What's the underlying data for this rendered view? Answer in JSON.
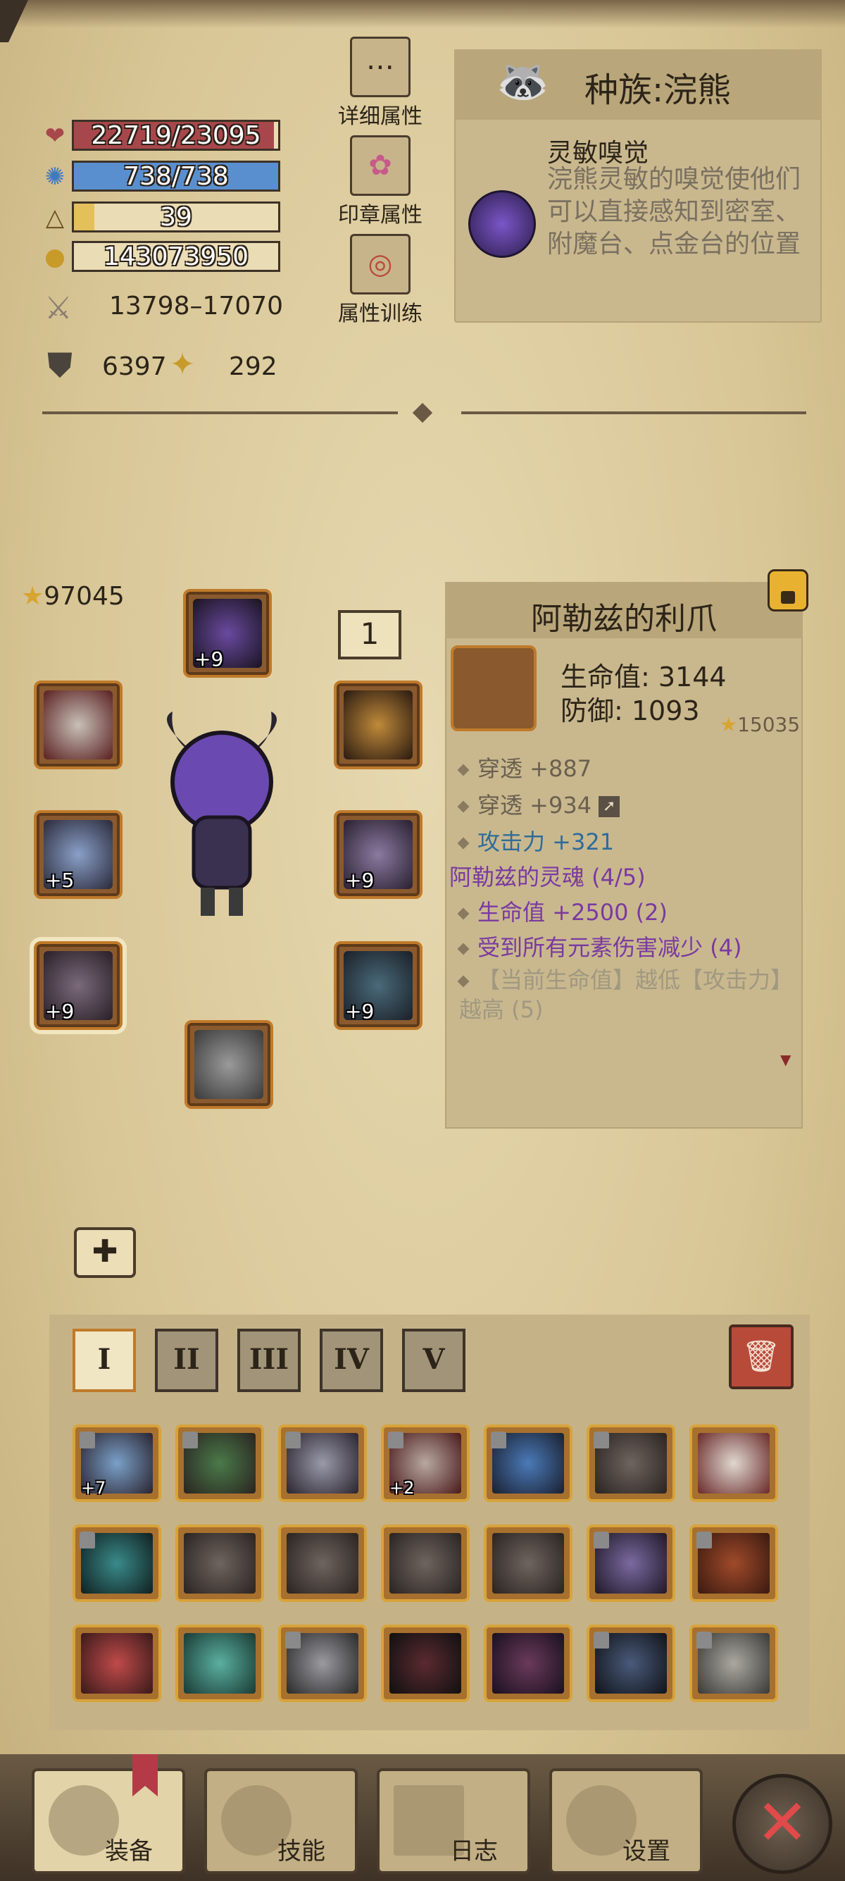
{
  "stats": {
    "hp": "22719/23095",
    "hp_fill": 0.98,
    "mp": "738/738",
    "mp_fill": 1.0,
    "level": "39",
    "level_fill": 0.1,
    "gold": "143073950",
    "attack": "13798–17070",
    "defense": "6397",
    "luck": "292"
  },
  "menu": {
    "detail": "详细属性",
    "seal": "印章属性",
    "training": "属性训练"
  },
  "race": {
    "title": "种族:浣熊",
    "trait_name": "灵敏嗅觉",
    "trait_desc": "浣熊灵敏的嗅觉使他们可以直接感知到密室、附魔台、点金台的位置"
  },
  "equip": {
    "score": "97045",
    "level_badge": "1",
    "helmet_plus": "+9",
    "weapon_plus": "+5",
    "claw_plus": "+9",
    "ring_plus": "+9",
    "armor_plus": "+9"
  },
  "item": {
    "title": "阿勒兹的利爪",
    "hp": "生命值: 3144",
    "def": "防御: 1093",
    "score": "15035",
    "lines": [
      "穿透 +887",
      "穿透 +934",
      "攻击力 +321",
      "阿勒兹的灵魂 (4/5)",
      "生命值 +2500 (2)",
      "受到所有元素伤害减少 (4)",
      "【当前生命值】越低【攻击力】越高 (5)"
    ]
  },
  "inventory": {
    "tabs": [
      "I",
      "II",
      "III",
      "IV",
      "V"
    ],
    "plus_sword": "+7",
    "plus_mask": "+2"
  },
  "nav": {
    "equip": "装备",
    "skills": "技能",
    "log": "日志",
    "settings": "设置"
  },
  "colors": {
    "hp": "#a8474b",
    "mp": "#5a8fcf",
    "xp": "#e3c05a",
    "accent": "#c07a2a",
    "set_purple": "#7a3aa0",
    "attack_blue": "#2e6c9a"
  }
}
